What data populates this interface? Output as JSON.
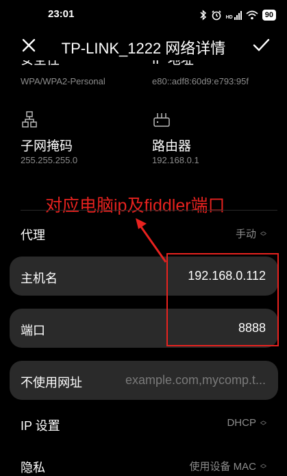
{
  "status_bar": {
    "time": "23:01",
    "icons": [
      "bluetooth-icon",
      "alarm-icon",
      "hd-signal-icon",
      "wifi-icon"
    ],
    "hd_label": "HD",
    "battery": "90"
  },
  "header": {
    "title": "TP-LINK_1222 网络详情"
  },
  "info": {
    "security": {
      "label": "安全性",
      "value": "WPA/WPA2-Personal"
    },
    "ip": {
      "label": "IP 地址",
      "value": "e80::adf8:60d9:e793:95f"
    },
    "subnet": {
      "label": "子网掩码",
      "value": "255.255.255.0"
    },
    "router": {
      "label": "路由器",
      "value": "192.168.0.1"
    }
  },
  "annotation": {
    "text": "对应电脑ip及fiddler端口",
    "color": "#e8221f"
  },
  "proxy": {
    "label": "代理",
    "value": "手动"
  },
  "hostname": {
    "label": "主机名",
    "value": "192.168.0.112"
  },
  "port": {
    "label": "端口",
    "value": "8888"
  },
  "bypass": {
    "label": "不使用网址",
    "placeholder": "example.com,mycomp.t..."
  },
  "ip_settings": {
    "label": "IP 设置",
    "value": "DHCP"
  },
  "privacy": {
    "label": "隐私",
    "value": "使用设备 MAC"
  }
}
